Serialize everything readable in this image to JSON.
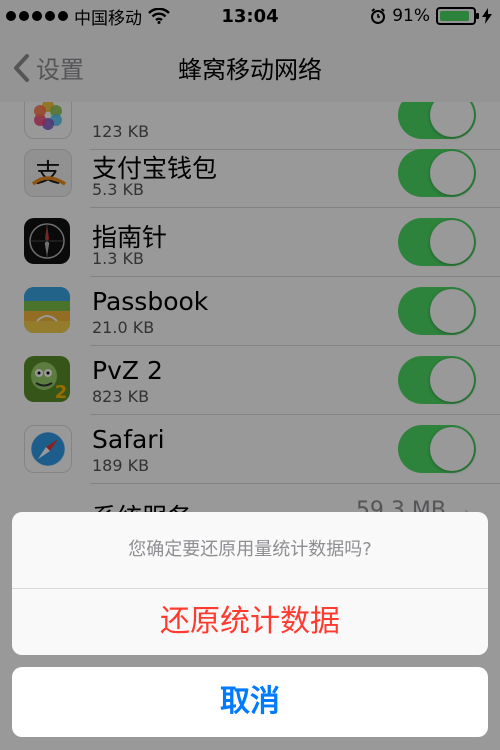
{
  "status_bar": {
    "carrier": "中国移动",
    "time": "13:04",
    "battery_percent": "91%",
    "battery_level": 0.91,
    "signal_icon": "signal-dots-icon",
    "wifi_icon": "wifi-icon",
    "alarm_icon": "alarm-icon",
    "charging_icon": "bolt-icon"
  },
  "nav": {
    "back_label": "设置",
    "title": "蜂窝移动网络"
  },
  "apps": [
    {
      "name": "",
      "size": "123 KB",
      "icon": "photos-icon",
      "enabled": true
    },
    {
      "name": "支付宝钱包",
      "size": "5.3 KB",
      "icon": "alipay-icon",
      "enabled": true
    },
    {
      "name": "指南针",
      "size": "1.3 KB",
      "icon": "compass-icon",
      "enabled": true
    },
    {
      "name": "Passbook",
      "size": "21.0 KB",
      "icon": "passbook-icon",
      "enabled": true
    },
    {
      "name": "PvZ 2",
      "size": "823 KB",
      "icon": "pvz-icon",
      "enabled": true
    },
    {
      "name": "Safari",
      "size": "189 KB",
      "icon": "safari-icon",
      "enabled": true
    }
  ],
  "system_services": {
    "label": "系统服务",
    "value": "59.3 MB"
  },
  "action_sheet": {
    "message": "您确定要还原用量统计数据吗?",
    "action_label": "还原统计数据",
    "cancel_label": "取消"
  },
  "colors": {
    "accent": "#007aff",
    "destructive": "#ff3b30",
    "switch_on": "#4cd964"
  }
}
